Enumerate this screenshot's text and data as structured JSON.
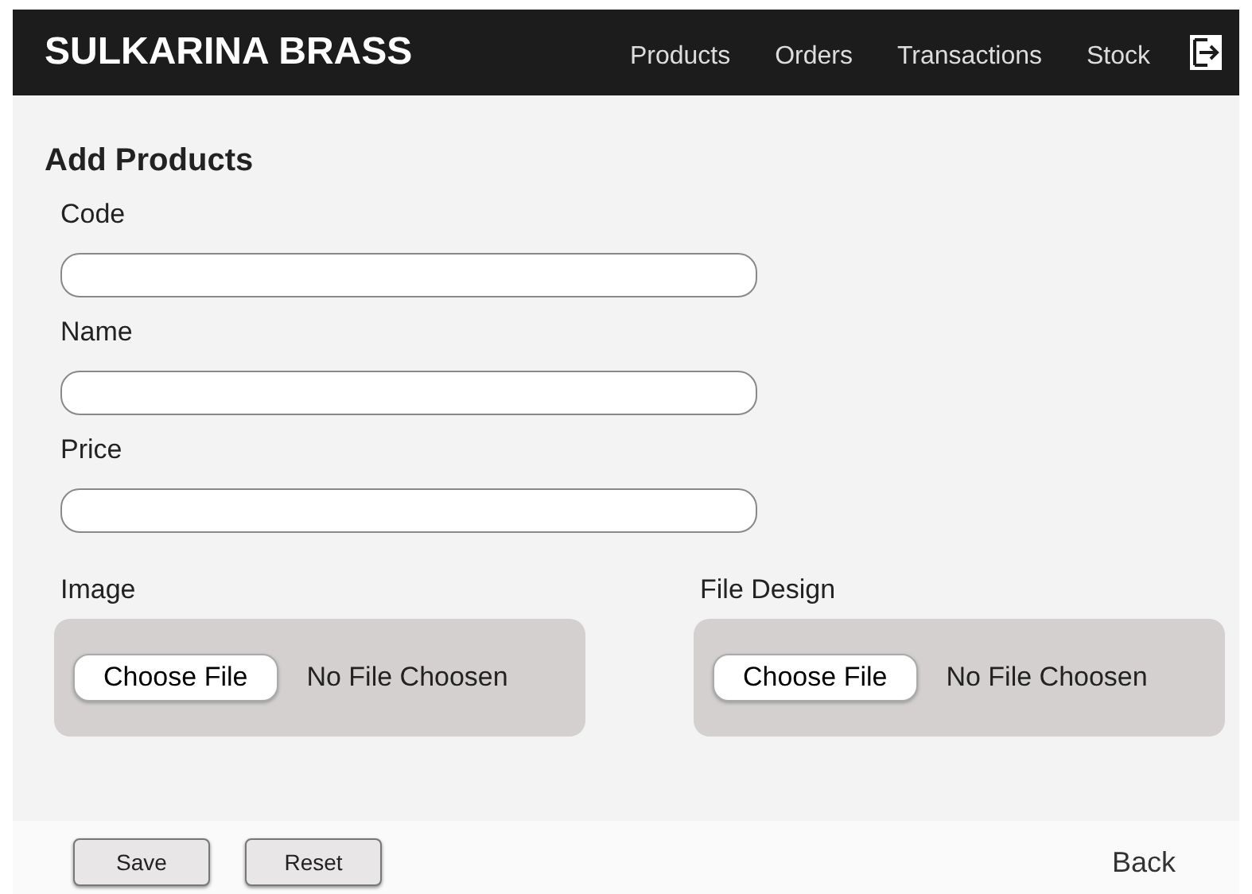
{
  "header": {
    "brand": "SULKARINA BRASS",
    "nav": [
      {
        "label": "Products",
        "selected": false
      },
      {
        "label": "Orders",
        "selected": false
      },
      {
        "label": "Transactions",
        "selected": false
      },
      {
        "label": "Stock",
        "selected": false
      }
    ]
  },
  "title": "Add Products",
  "fields": [
    {
      "label": "Code"
    },
    {
      "label": "Name"
    },
    {
      "label": "Price"
    }
  ],
  "uploads": [
    {
      "label": "Image",
      "button": "Choose File",
      "status": "No File Choosen"
    },
    {
      "label": "File Design",
      "button": "Choose File",
      "status": "No File Choosen"
    }
  ],
  "footer": {
    "buttons": [
      "Save",
      "Reset"
    ],
    "back": "Back"
  }
}
